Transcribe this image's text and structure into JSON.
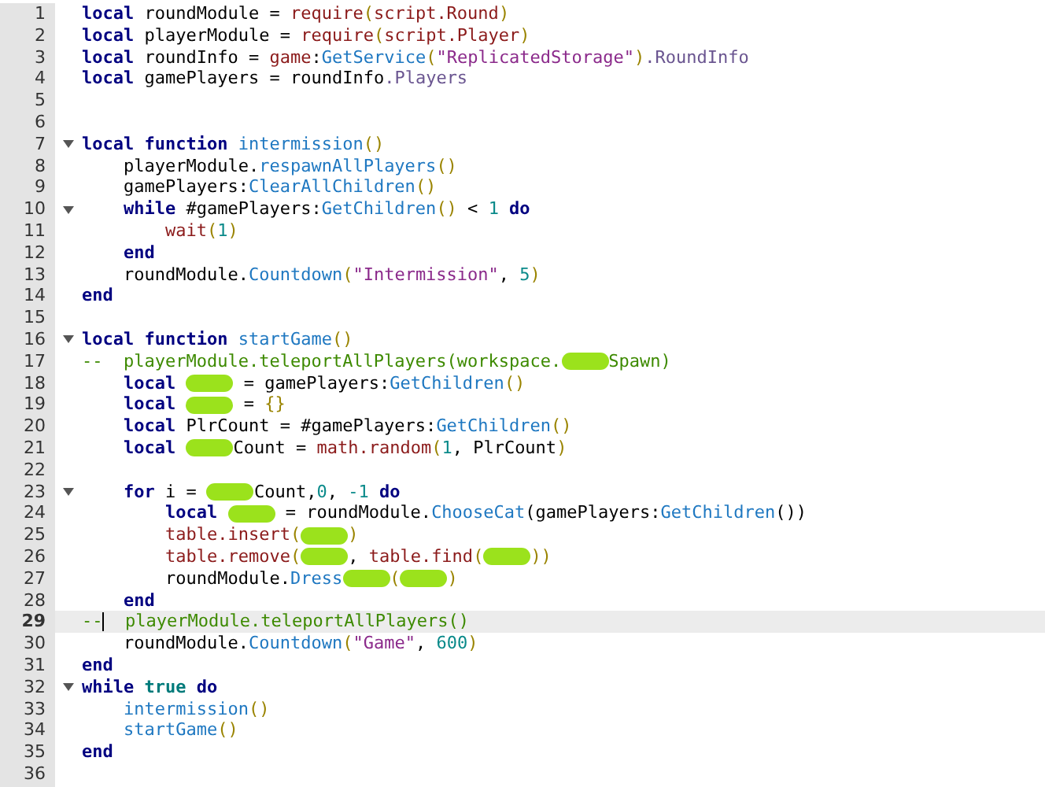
{
  "editor": {
    "lines": [
      {
        "number": "1",
        "tokens": [
          {
            "kind": "keyword",
            "text": "local"
          },
          {
            "kind": "plain",
            "text": " roundModule = "
          },
          {
            "kind": "builtin",
            "text": "require"
          },
          {
            "kind": "paren",
            "text": "("
          },
          {
            "kind": "builtin",
            "text": "script.Round"
          },
          {
            "kind": "paren",
            "text": ")"
          }
        ]
      },
      {
        "number": "2",
        "tokens": [
          {
            "kind": "keyword",
            "text": "local"
          },
          {
            "kind": "plain",
            "text": " playerModule = "
          },
          {
            "kind": "builtin",
            "text": "require"
          },
          {
            "kind": "paren",
            "text": "("
          },
          {
            "kind": "builtin",
            "text": "script.Player"
          },
          {
            "kind": "paren",
            "text": ")"
          }
        ]
      },
      {
        "number": "3",
        "tokens": [
          {
            "kind": "keyword",
            "text": "local"
          },
          {
            "kind": "plain",
            "text": " roundInfo = "
          },
          {
            "kind": "builtin",
            "text": "game"
          },
          {
            "kind": "plain",
            "text": ":"
          },
          {
            "kind": "method",
            "text": "GetService"
          },
          {
            "kind": "paren",
            "text": "("
          },
          {
            "kind": "string",
            "text": "\"ReplicatedStorage\""
          },
          {
            "kind": "paren",
            "text": ")"
          },
          {
            "kind": "property",
            "text": ".RoundInfo"
          }
        ]
      },
      {
        "number": "4",
        "tokens": [
          {
            "kind": "keyword",
            "text": "local"
          },
          {
            "kind": "plain",
            "text": " gamePlayers = roundInfo"
          },
          {
            "kind": "property",
            "text": ".Players"
          }
        ]
      },
      {
        "number": "5"
      },
      {
        "number": "6"
      },
      {
        "number": "7",
        "fold": true,
        "tokens": [
          {
            "kind": "keyword",
            "text": "local function "
          },
          {
            "kind": "method",
            "text": "intermission"
          },
          {
            "kind": "paren",
            "text": "()"
          }
        ]
      },
      {
        "number": "8",
        "tokens": [
          {
            "kind": "plain",
            "text": "    playerModule."
          },
          {
            "kind": "method",
            "text": "respawnAllPlayers"
          },
          {
            "kind": "paren",
            "text": "()"
          }
        ]
      },
      {
        "number": "9",
        "tokens": [
          {
            "kind": "plain",
            "text": "    gamePlayers:"
          },
          {
            "kind": "method",
            "text": "ClearAllChildren"
          },
          {
            "kind": "paren",
            "text": "()"
          }
        ]
      },
      {
        "number": "10",
        "fold": true,
        "tokens": [
          {
            "kind": "keyword",
            "text": "    while"
          },
          {
            "kind": "plain",
            "text": " #gamePlayers:"
          },
          {
            "kind": "method",
            "text": "GetChildren"
          },
          {
            "kind": "paren",
            "text": "()"
          },
          {
            "kind": "plain",
            "text": " < "
          },
          {
            "kind": "number",
            "text": "1"
          },
          {
            "kind": "keyword",
            "text": " do"
          }
        ]
      },
      {
        "number": "11",
        "tokens": [
          {
            "kind": "builtin",
            "text": "        wait"
          },
          {
            "kind": "paren",
            "text": "("
          },
          {
            "kind": "number",
            "text": "1"
          },
          {
            "kind": "paren",
            "text": ")"
          }
        ]
      },
      {
        "number": "12",
        "tokens": [
          {
            "kind": "keyword",
            "text": "    end"
          }
        ]
      },
      {
        "number": "13",
        "tokens": [
          {
            "kind": "plain",
            "text": "    roundModule."
          },
          {
            "kind": "method",
            "text": "Countdown"
          },
          {
            "kind": "paren",
            "text": "("
          },
          {
            "kind": "string",
            "text": "\"Intermission\""
          },
          {
            "kind": "plain",
            "text": ", "
          },
          {
            "kind": "number",
            "text": "5"
          },
          {
            "kind": "paren",
            "text": ")"
          }
        ]
      },
      {
        "number": "14",
        "tokens": [
          {
            "kind": "keyword",
            "text": "end"
          }
        ]
      },
      {
        "number": "15"
      },
      {
        "number": "16",
        "fold": true,
        "tokens": [
          {
            "kind": "keyword",
            "text": "local function "
          },
          {
            "kind": "method",
            "text": "startGame"
          },
          {
            "kind": "paren",
            "text": "()"
          }
        ]
      },
      {
        "number": "17",
        "tokens": [
          {
            "kind": "comment",
            "text": "--  playerModule.teleportAllPlayers(workspace."
          },
          {
            "kind": "redacted"
          },
          {
            "kind": "comment",
            "text": "Spawn)"
          }
        ]
      },
      {
        "number": "18",
        "tokens": [
          {
            "kind": "keyword",
            "text": "    local "
          },
          {
            "kind": "redacted"
          },
          {
            "kind": "plain",
            "text": " = gamePlayers:"
          },
          {
            "kind": "method",
            "text": "GetChildren"
          },
          {
            "kind": "paren",
            "text": "()"
          }
        ]
      },
      {
        "number": "19",
        "tokens": [
          {
            "kind": "keyword",
            "text": "    local "
          },
          {
            "kind": "redacted"
          },
          {
            "kind": "plain",
            "text": " = "
          },
          {
            "kind": "paren",
            "text": "{}"
          }
        ]
      },
      {
        "number": "20",
        "tokens": [
          {
            "kind": "keyword",
            "text": "    local"
          },
          {
            "kind": "plain",
            "text": " PlrCount = #gamePlayers:"
          },
          {
            "kind": "method",
            "text": "GetChildren"
          },
          {
            "kind": "paren",
            "text": "()"
          }
        ]
      },
      {
        "number": "21",
        "tokens": [
          {
            "kind": "keyword",
            "text": "    local "
          },
          {
            "kind": "redacted"
          },
          {
            "kind": "plain",
            "text": "Count = "
          },
          {
            "kind": "builtin",
            "text": "math.random"
          },
          {
            "kind": "paren",
            "text": "("
          },
          {
            "kind": "number",
            "text": "1"
          },
          {
            "kind": "plain",
            "text": ", PlrCount"
          },
          {
            "kind": "paren",
            "text": ")"
          }
        ]
      },
      {
        "number": "22"
      },
      {
        "number": "23",
        "fold": true,
        "tokens": [
          {
            "kind": "keyword",
            "text": "    for"
          },
          {
            "kind": "plain",
            "text": " i = "
          },
          {
            "kind": "redacted"
          },
          {
            "kind": "plain",
            "text": "Count,"
          },
          {
            "kind": "number",
            "text": "0"
          },
          {
            "kind": "plain",
            "text": ", "
          },
          {
            "kind": "number",
            "text": "-1"
          },
          {
            "kind": "keyword",
            "text": " do"
          }
        ]
      },
      {
        "number": "24",
        "tokens": [
          {
            "kind": "keyword",
            "text": "        local "
          },
          {
            "kind": "redacted"
          },
          {
            "kind": "plain",
            "text": " = roundModule."
          },
          {
            "kind": "method",
            "text": "ChooseCat"
          },
          {
            "kind": "plain",
            "text": "(gamePlayers:"
          },
          {
            "kind": "method",
            "text": "GetChildren"
          },
          {
            "kind": "plain",
            "text": "())"
          }
        ]
      },
      {
        "number": "25",
        "tokens": [
          {
            "kind": "builtin",
            "text": "        table.insert"
          },
          {
            "kind": "paren",
            "text": "("
          },
          {
            "kind": "redacted"
          },
          {
            "kind": "paren",
            "text": ")"
          }
        ]
      },
      {
        "number": "26",
        "tokens": [
          {
            "kind": "builtin",
            "text": "        table.remove"
          },
          {
            "kind": "paren",
            "text": "("
          },
          {
            "kind": "redacted"
          },
          {
            "kind": "plain",
            "text": ", "
          },
          {
            "kind": "builtin",
            "text": "table.find"
          },
          {
            "kind": "paren",
            "text": "("
          },
          {
            "kind": "redacted"
          },
          {
            "kind": "paren",
            "text": "))"
          }
        ]
      },
      {
        "number": "27",
        "tokens": [
          {
            "kind": "plain",
            "text": "        roundModule."
          },
          {
            "kind": "method",
            "text": "Dress"
          },
          {
            "kind": "redacted"
          },
          {
            "kind": "paren",
            "text": "("
          },
          {
            "kind": "redacted"
          },
          {
            "kind": "paren",
            "text": ")"
          }
        ]
      },
      {
        "number": "28",
        "tokens": [
          {
            "kind": "keyword",
            "text": "    end"
          }
        ]
      },
      {
        "number": "29",
        "current": true,
        "tokens": [
          {
            "kind": "comment",
            "text": "--"
          },
          {
            "kind": "comment",
            "text": "  playerModule.teleportAllPlayers()"
          }
        ]
      },
      {
        "number": "30",
        "tokens": [
          {
            "kind": "plain",
            "text": "    roundModule."
          },
          {
            "kind": "method",
            "text": "Countdown"
          },
          {
            "kind": "paren",
            "text": "("
          },
          {
            "kind": "string",
            "text": "\"Game\""
          },
          {
            "kind": "plain",
            "text": ", "
          },
          {
            "kind": "number",
            "text": "600"
          },
          {
            "kind": "paren",
            "text": ")"
          }
        ]
      },
      {
        "number": "31",
        "tokens": [
          {
            "kind": "keyword",
            "text": "end"
          }
        ]
      },
      {
        "number": "32",
        "fold": true,
        "tokens": [
          {
            "kind": "keyword",
            "text": "while "
          },
          {
            "kind": "literal",
            "text": "true"
          },
          {
            "kind": "keyword",
            "text": " do"
          }
        ]
      },
      {
        "number": "33",
        "tokens": [
          {
            "kind": "method",
            "text": "    intermission"
          },
          {
            "kind": "paren",
            "text": "()"
          }
        ]
      },
      {
        "number": "34",
        "tokens": [
          {
            "kind": "method",
            "text": "    startGame"
          },
          {
            "kind": "paren",
            "text": "()"
          }
        ]
      },
      {
        "number": "35",
        "tokens": [
          {
            "kind": "keyword",
            "text": "end"
          }
        ]
      },
      {
        "number": "36"
      }
    ]
  }
}
